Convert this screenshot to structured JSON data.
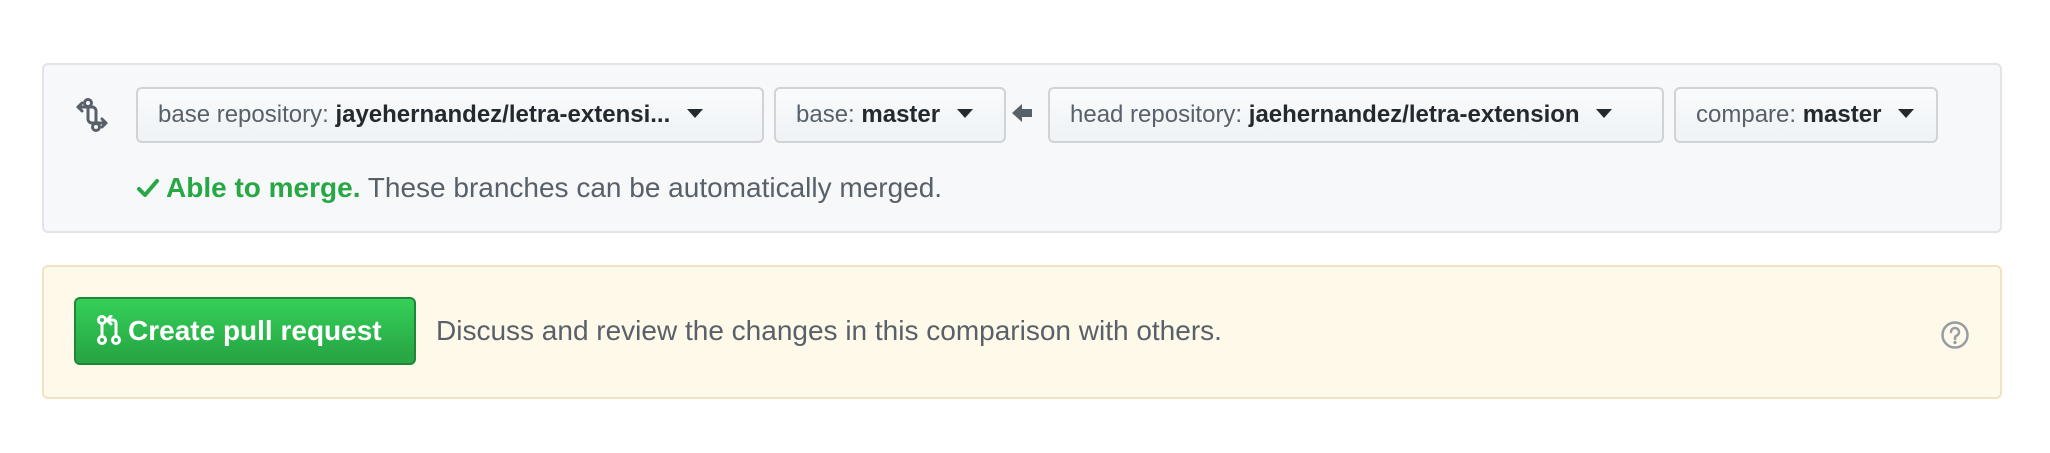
{
  "compare": {
    "base_repo_label": "base repository:",
    "base_repo_value": "jayehernandez/letra-extensi...",
    "base_label": "base:",
    "base_value": "master",
    "head_repo_label": "head repository:",
    "head_repo_value": "jaehernandez/letra-extension",
    "compare_label": "compare:",
    "compare_value": "master",
    "merge_status_strong": "Able to merge.",
    "merge_status_text": "These branches can be automatically merged."
  },
  "pull_request": {
    "create_label": "Create pull request",
    "description": "Discuss and review the changes in this comparison with others."
  },
  "colors": {
    "success": "#28a745",
    "muted_text": "#586069",
    "panel_bg": "#f6f8fa",
    "warning_bg": "#fff9ea"
  },
  "icons": {
    "compare": "git-compare-icon",
    "arrow": "arrow-left-icon",
    "check": "check-icon",
    "pull_request": "git-pull-request-icon",
    "help": "question-circle-icon"
  }
}
